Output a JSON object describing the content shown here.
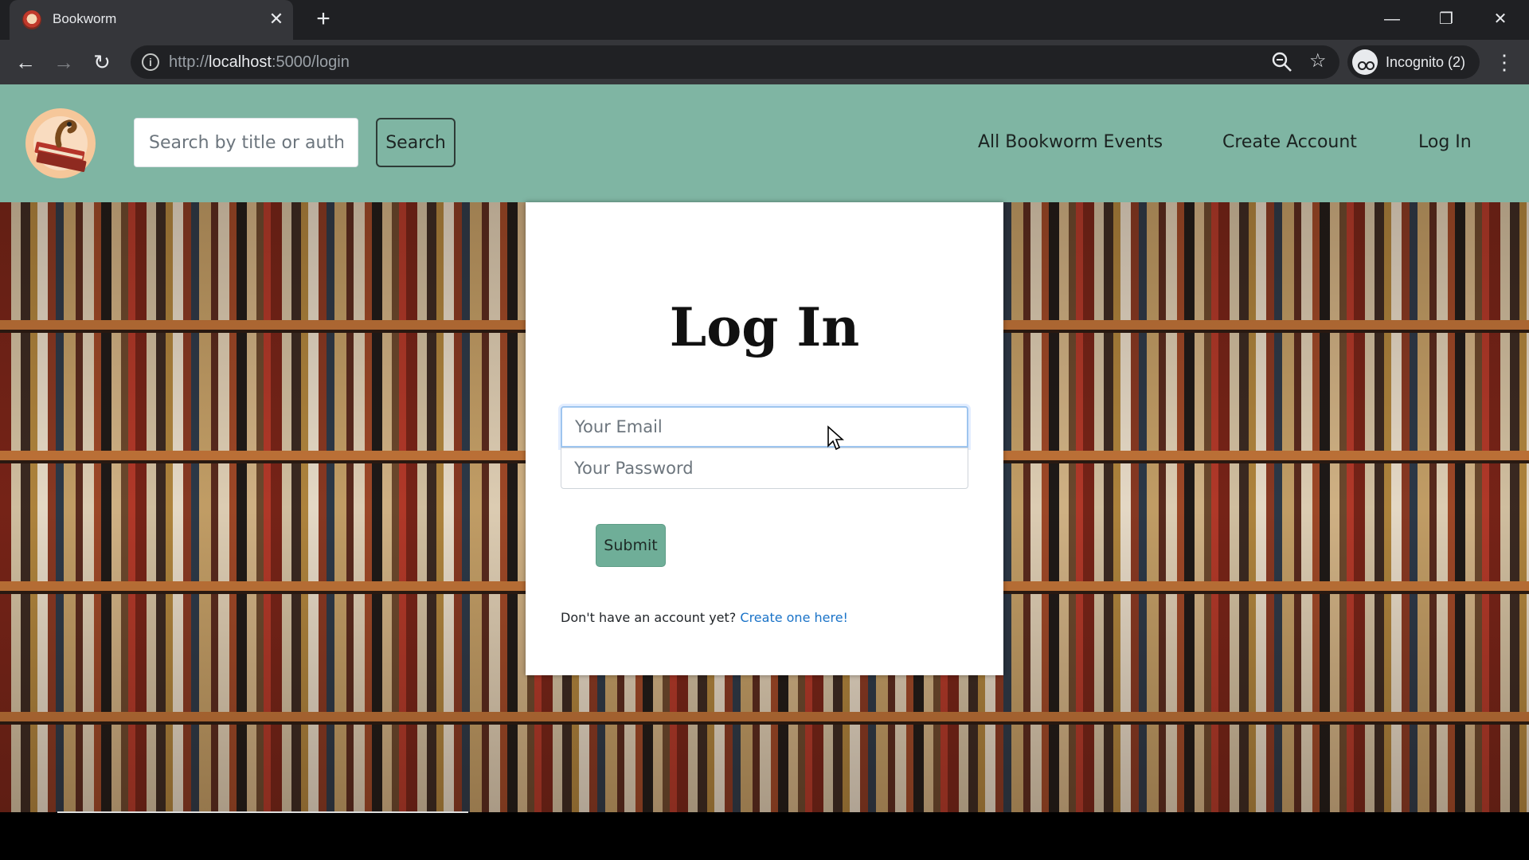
{
  "browser": {
    "tab_title": "Bookworm",
    "tab_close": "✕",
    "new_tab": "+",
    "url_prefix": "http://",
    "url_host": "localhost",
    "url_path": ":5000/login",
    "profile_label": "Incognito (2)",
    "window_controls": {
      "minimize": "—",
      "restore": "❐",
      "close": "✕"
    },
    "icons": [
      "back-arrow-icon",
      "forward-arrow-icon",
      "reload-icon",
      "site-info-icon",
      "zoom-icon",
      "star-icon",
      "incognito-icon",
      "more-menu-icon"
    ]
  },
  "site": {
    "search_placeholder": "Search by title or author",
    "search_button": "Search",
    "nav": {
      "events": "All Bookworm Events",
      "create_account": "Create Account",
      "log_in": "Log In"
    },
    "brand_colors": {
      "navbar": "#7fb5a3",
      "submit": "#6fae98",
      "link": "#1a73c8"
    }
  },
  "login": {
    "title": "Log In",
    "email_placeholder": "Your Email",
    "password_placeholder": "Your Password",
    "submit_label": "Submit",
    "signup_prompt": "Don't have an account yet?",
    "signup_link": "Create one here!"
  }
}
